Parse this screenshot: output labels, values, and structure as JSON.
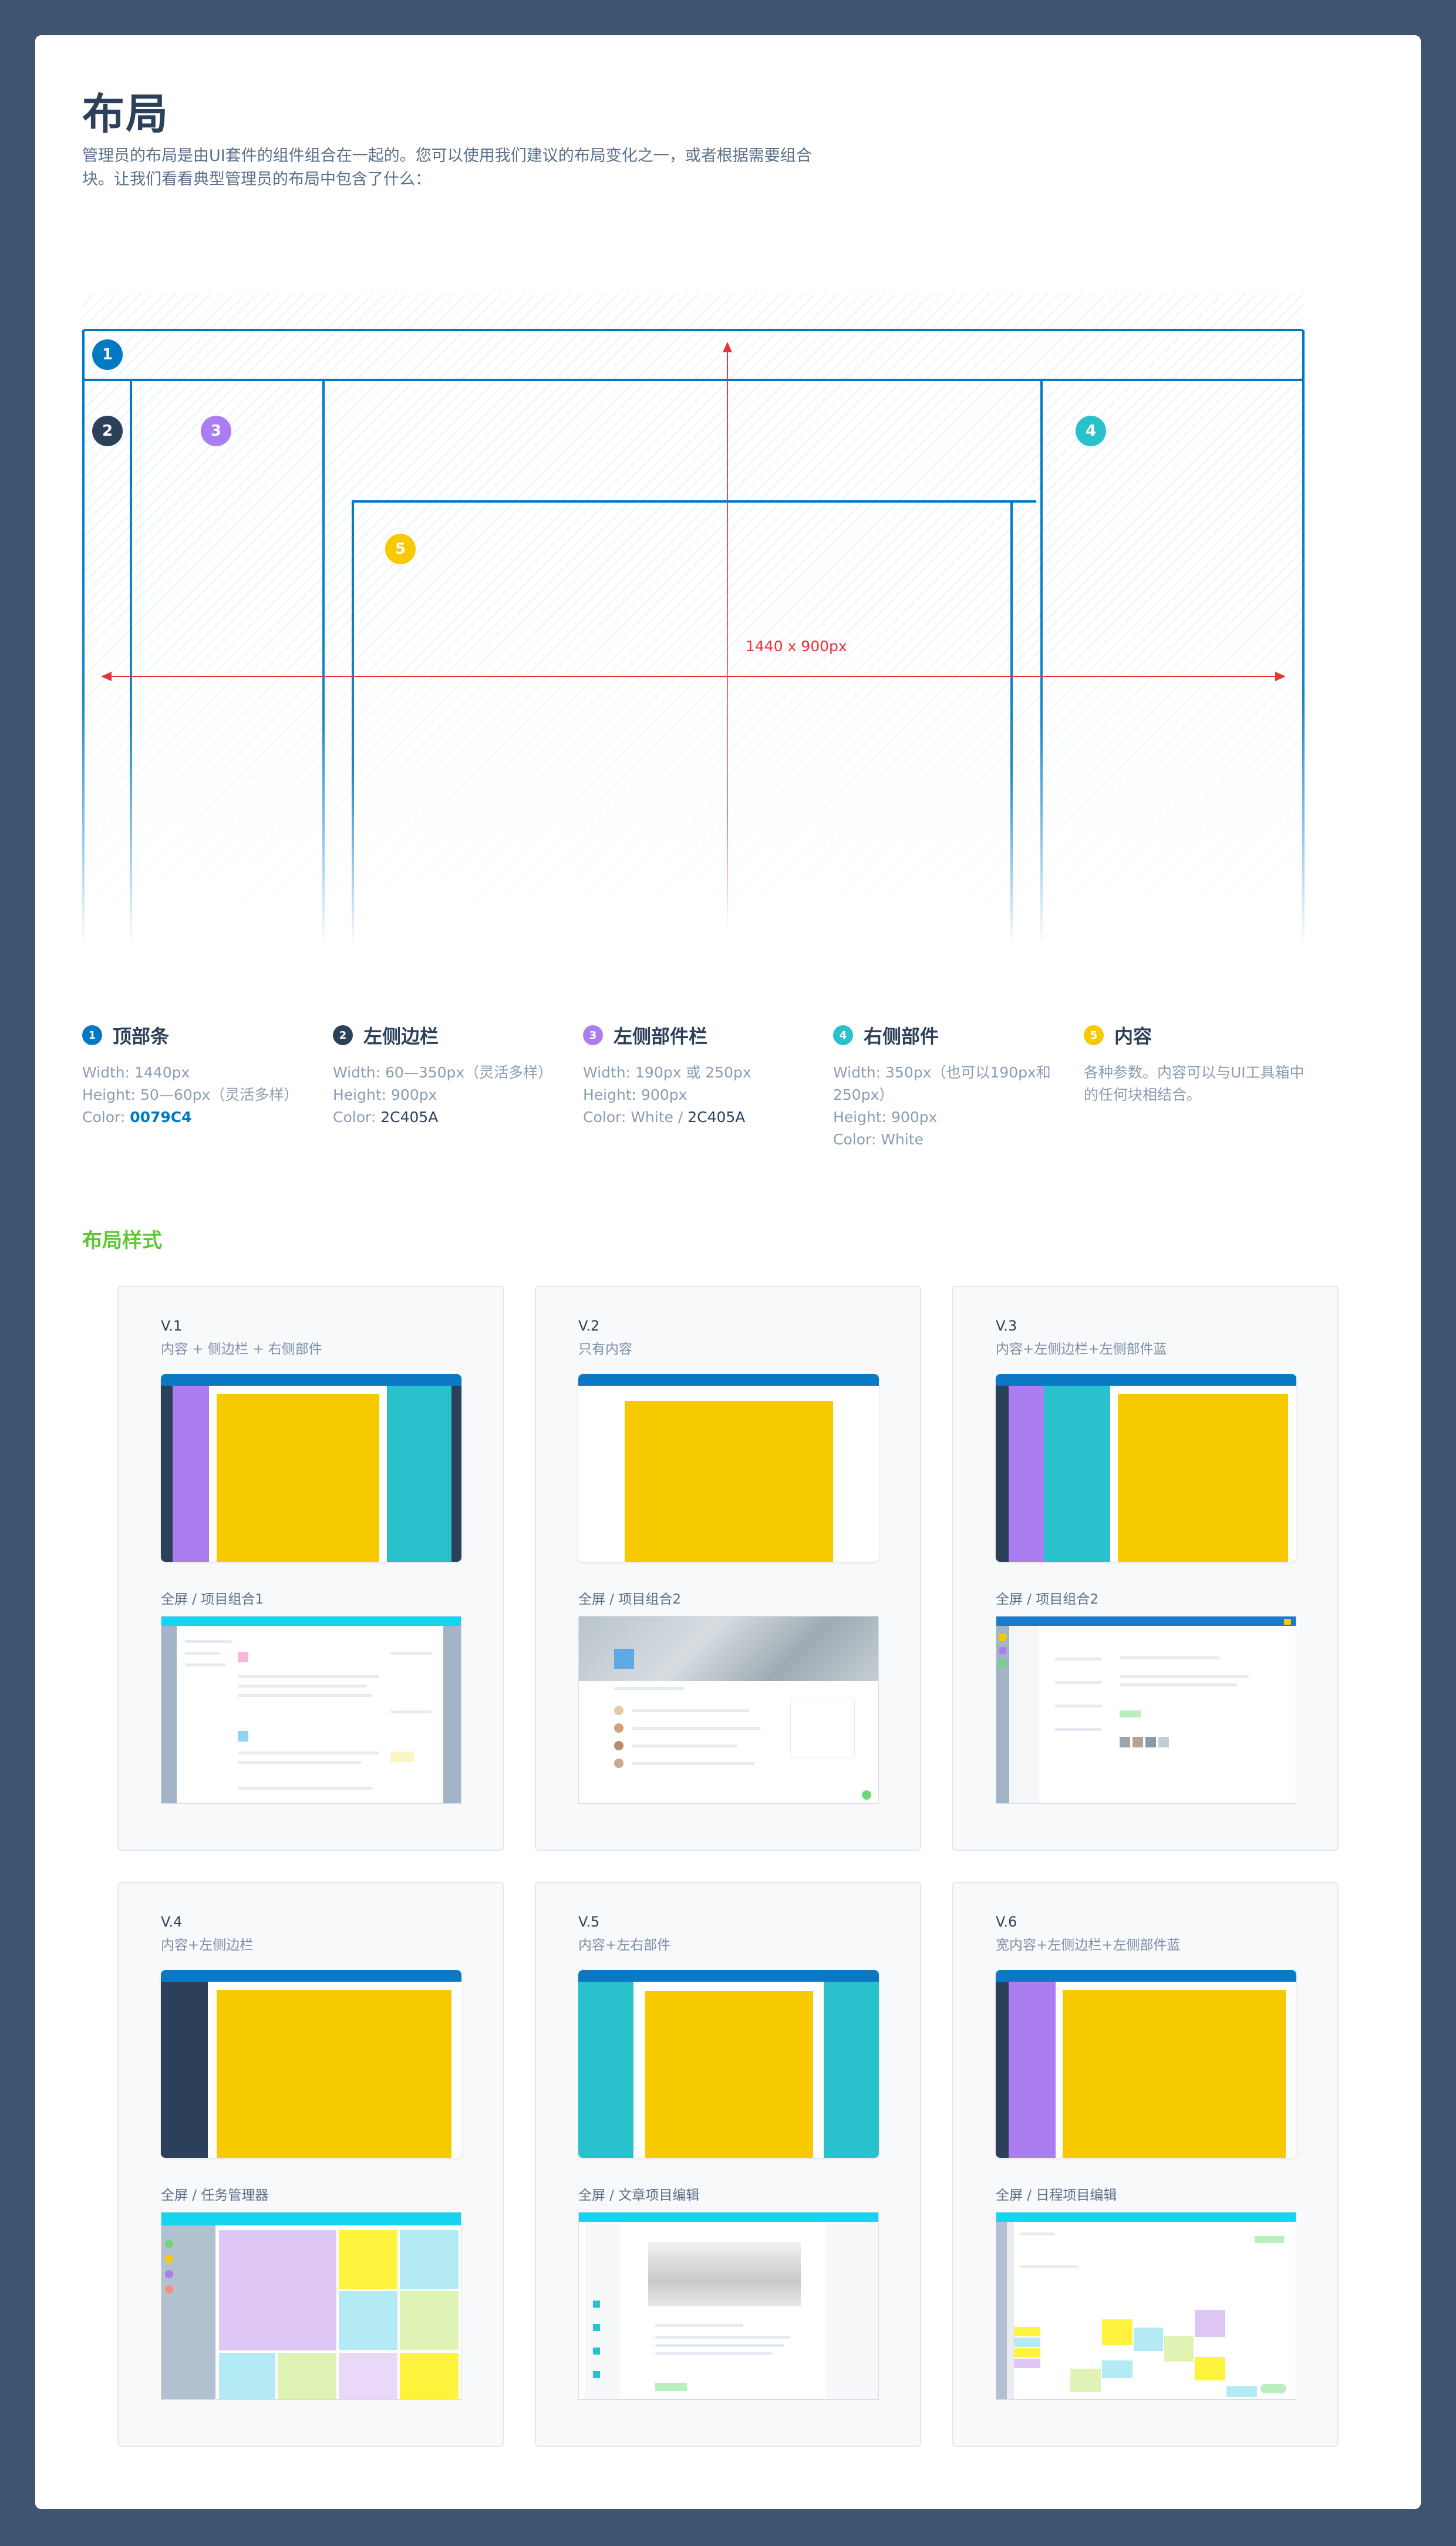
{
  "page": {
    "title": "布局",
    "intro": "管理员的布局是由UI套件的组件组合在一起的。您可以使用我们建议的布局变化之一，或者根据需要组合块。让我们看看典型管理员的布局中包含了什么："
  },
  "diagram": {
    "dimension_label": "1440 x 900px",
    "markers": [
      "1",
      "2",
      "3",
      "4",
      "5"
    ],
    "colors": {
      "topbar": "#0079C4",
      "left_sidebar": "#2C405A",
      "left_widgets": "#AA7EF0",
      "right_widgets": "#29C2CC",
      "content": "#F7CA00",
      "guide": "#E5343B"
    }
  },
  "legend": [
    {
      "num": "1",
      "title": "顶部条",
      "lines": [
        "Width: 1440px",
        "Height: 50—60px（灵活多样）"
      ],
      "color_prefix": "Color: ",
      "color_value": "0079C4",
      "color_extra": ""
    },
    {
      "num": "2",
      "title": "左侧边栏",
      "lines": [
        "Width: 60—350px（灵活多样）",
        "Height: 900px"
      ],
      "color_prefix": "Color: ",
      "color_value": "2C405A",
      "color_extra": ""
    },
    {
      "num": "3",
      "title": "左侧部件栏",
      "lines": [
        "Width: 190px 或 250px",
        "Height: 900px"
      ],
      "color_prefix": "Color: White / ",
      "color_value": "2C405A",
      "color_extra": ""
    },
    {
      "num": "4",
      "title": "右侧部件",
      "lines": [
        "Width: 350px（也可以190px和250px）",
        "Height: 900px",
        "Color: White"
      ],
      "color_prefix": "",
      "color_value": "",
      "color_extra": ""
    },
    {
      "num": "5",
      "title": "内容",
      "lines": [
        "各种参数。内容可以与UI工具箱中的任何块相结合。"
      ],
      "color_prefix": "",
      "color_value": "",
      "color_extra": ""
    }
  ],
  "section_title": "布局样式",
  "cards": [
    {
      "version": "V.1",
      "desc": "内容 + 侧边栏 + 右侧部件",
      "sub": "全屏 / 项目组合1"
    },
    {
      "version": "V.2",
      "desc": "只有内容",
      "sub": "全屏 / 项目组合2"
    },
    {
      "version": "V.3",
      "desc": "内容+左侧边栏+左侧部件蓝",
      "sub": "全屏 / 项目组合2"
    },
    {
      "version": "V.4",
      "desc": "内容+左侧边栏",
      "sub": "全屏 / 任务管理器"
    },
    {
      "version": "V.5",
      "desc": "内容+左右部件",
      "sub": "全屏 / 文章项目编辑"
    },
    {
      "version": "V.6",
      "desc": "宽内容+左侧边栏+左侧部件蓝",
      "sub": "全屏 / 日程项目编辑"
    }
  ]
}
